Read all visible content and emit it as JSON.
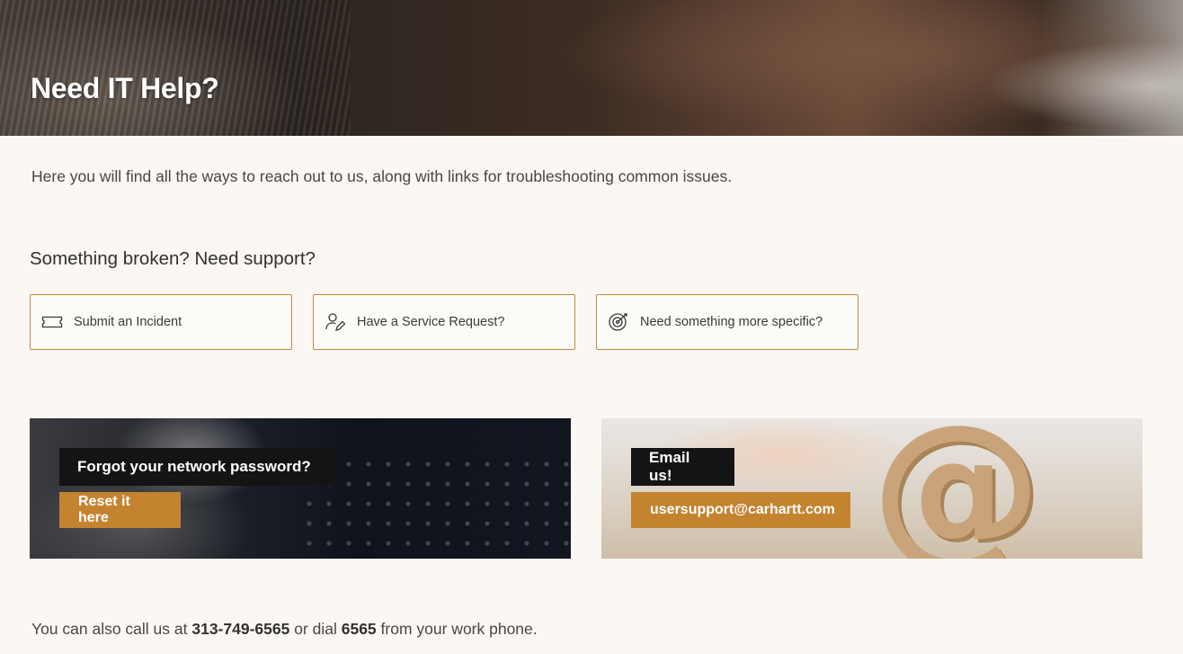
{
  "hero": {
    "title": "Need IT Help?"
  },
  "intro_text": "Here you will find all the ways to reach out to us, along with links for troubleshooting common issues.",
  "support": {
    "title": "Something broken? Need support?",
    "cards": [
      {
        "label": "Submit an Incident",
        "icon": "ticket-icon"
      },
      {
        "label": "Have a Service Request?",
        "icon": "person-edit-icon"
      },
      {
        "label": "Need something more specific?",
        "icon": "at-target-icon"
      }
    ]
  },
  "promos": {
    "password": {
      "heading": "Forgot your network password?",
      "button": "Reset it here"
    },
    "email": {
      "heading": "Email us!",
      "button": "usersupport@carhartt.com"
    }
  },
  "footer": {
    "prefix": "You can also call us at ",
    "phone": "313-749-6565",
    "middle": " or dial ",
    "extension": "6565",
    "suffix": " from your work phone."
  },
  "colors": {
    "accent": "#c4832f",
    "card_border": "#c4893e",
    "background": "#fbf8f4"
  }
}
